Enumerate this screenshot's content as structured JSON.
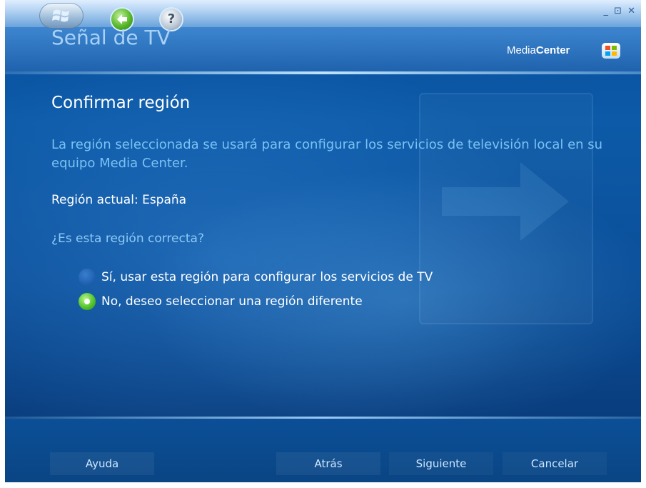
{
  "window": {
    "controls": "_ ⊡ ✕"
  },
  "header": {
    "title": "Señal de TV",
    "brand_light": "Media",
    "brand_bold": "Center"
  },
  "main": {
    "heading": "Confirmar región",
    "description": "La región seleccionada se usará para configurar los servicios de televisión local en su equipo Media Center.",
    "current_region": "Región actual: España",
    "question": "¿Es esta región correcta?",
    "options": [
      {
        "label": "Sí, usar esta región para configurar los servicios de TV",
        "selected": false
      },
      {
        "label": "No, deseo seleccionar una región diferente",
        "selected": true
      }
    ]
  },
  "footer": {
    "help": "Ayuda",
    "back": "Atrás",
    "next": "Siguiente",
    "cancel": "Cancelar"
  },
  "icons": {
    "start": "windows-start-icon",
    "back": "back-arrow-icon",
    "help": "help-icon",
    "brand_logo": "windows-flag-icon"
  },
  "colors": {
    "accent_blue": "#0c5aa8",
    "title": "#a9d1f7",
    "description": "#7ac2f4",
    "selected_radio": "#54c52c"
  }
}
